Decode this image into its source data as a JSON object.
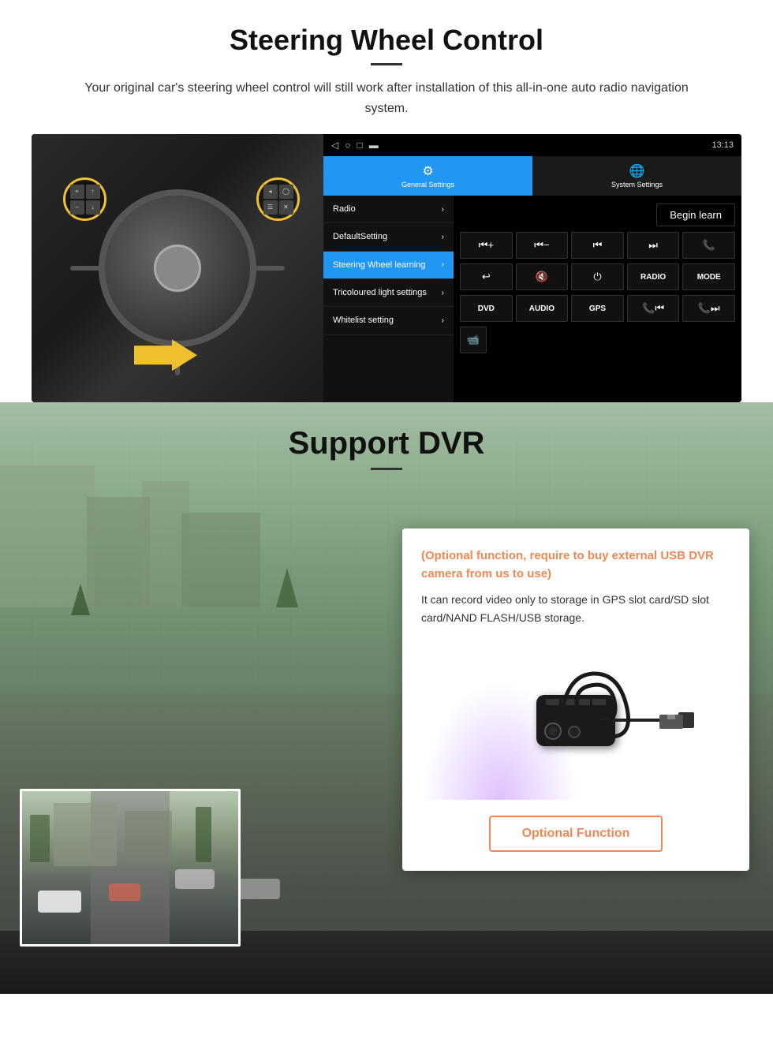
{
  "steering": {
    "title": "Steering Wheel Control",
    "subtitle": "Your original car's steering wheel control will still work after installation of this all-in-one auto radio navigation system.",
    "tabs": {
      "general": "General Settings",
      "system": "System Settings"
    },
    "menu": [
      {
        "id": "radio",
        "label": "Radio",
        "active": false
      },
      {
        "id": "default",
        "label": "DefaultSetting",
        "active": false
      },
      {
        "id": "steering",
        "label": "Steering Wheel learning",
        "active": true
      },
      {
        "id": "tricoloured",
        "label": "Tricoloured light settings",
        "active": false
      },
      {
        "id": "whitelist",
        "label": "Whitelist setting",
        "active": false
      }
    ],
    "begin_learn": "Begin learn",
    "statusbar_time": "13:13",
    "controls": {
      "row1": [
        "⏮+",
        "⏮−",
        "⏮⏮",
        "⏭⏭",
        "📞"
      ],
      "row2": [
        "↩",
        "🔇",
        "⏻",
        "RADIO",
        "MODE"
      ],
      "row3": [
        "DVD",
        "AUDIO",
        "GPS",
        "📞⏮",
        "📞⏭"
      ]
    }
  },
  "dvr": {
    "title": "Support DVR",
    "optional_text": "(Optional function, require to buy external USB DVR camera from us to use)",
    "description": "It can record video only to storage in GPS slot card/SD slot card/NAND FLASH/USB storage.",
    "button_label": "Optional Function"
  }
}
